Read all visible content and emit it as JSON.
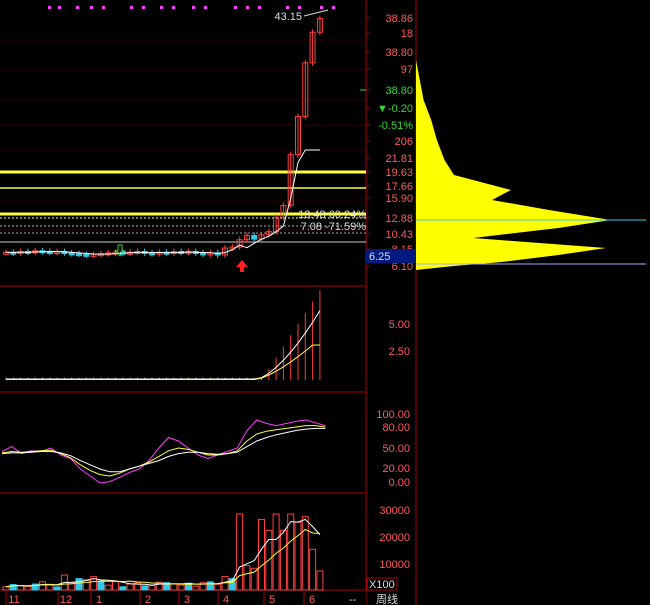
{
  "chart_data": [
    {
      "type": "candlestick",
      "panel": "price",
      "y_ticks": [
        "38.86",
        "18",
        "38.80",
        "97",
        "38.80",
        "-0.20",
        "-0.51%",
        "206",
        "21.81",
        "19.63",
        "17.66",
        "15.90",
        "12.88",
        "10.43",
        "8.15",
        "6.10"
      ],
      "current_price_tag": "6.25",
      "high_label": "43.15",
      "annotation_upper": "13.48  60.24%",
      "annotation_lower": "7.08  -71.59%",
      "horizontal_lines": [
        19.6,
        16.8,
        13.5,
        12.9
      ],
      "candles_weekly_close": [
        6.4,
        6.3,
        6.5,
        6.4,
        6.6,
        6.5,
        6.4,
        6.5,
        6.3,
        6.2,
        6.1,
        6.0,
        6.1,
        6.2,
        6.3,
        6.4,
        6.3,
        6.4,
        6.5,
        6.3,
        6.2,
        6.4,
        6.3,
        6.5,
        6.4,
        6.5,
        6.3,
        6.1,
        6.3,
        6.0,
        7.0,
        8.3,
        9.5,
        10.2,
        9.6,
        10.3,
        10.8,
        13.0,
        14.6,
        21.0,
        26.0,
        33.0,
        37.0,
        38.8
      ]
    },
    {
      "type": "bar",
      "panel": "volatility",
      "y_ticks": [
        "5.00",
        "2.50"
      ],
      "ylim": [
        0,
        7
      ]
    },
    {
      "type": "line",
      "panel": "oscillator",
      "y_ticks": [
        "100.00",
        "80.00",
        "50.00",
        "20.00",
        "0.00"
      ],
      "ylim": [
        -10,
        110
      ]
    },
    {
      "type": "bar",
      "panel": "volume",
      "y_ticks": [
        "30000",
        "20000",
        "10000"
      ],
      "unit_label": "X100",
      "ylim": [
        0,
        35000
      ]
    }
  ],
  "x_axis": {
    "labels": [
      "11",
      "12",
      "1",
      "2",
      "3",
      "4",
      "5",
      "6"
    ],
    "period_button": "周线",
    "nav_button": "--"
  },
  "colors": {
    "background": "#000000",
    "up": "#ff4040",
    "down": "#35c8e8",
    "line_white": "#ffffff",
    "line_yellow": "#ffff3c",
    "line_magenta": "#ff3cff",
    "axis_red": "#b00000",
    "volume_profile": "#ffff00",
    "price_tag": "#001a80"
  }
}
